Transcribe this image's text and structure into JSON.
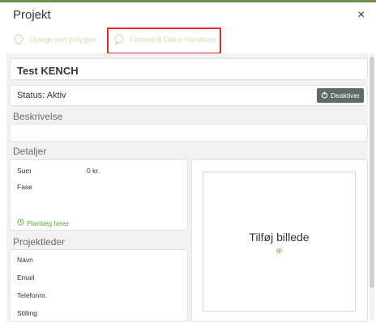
{
  "header": {
    "title": "Projekt",
    "close_glyph": "×",
    "accent_color": "#6f8f4a"
  },
  "toolbar": {
    "items": [
      {
        "label": "Optegn kort-polygon",
        "icon": "map-marker-icon"
      },
      {
        "label": "Forbind til Dalux Handover",
        "icon": "chat-bubble-icon"
      }
    ]
  },
  "project": {
    "name": "Test KENCH",
    "status_label": "Status:",
    "status_value": "Aktiv",
    "deactivate_label": "Deaktiver",
    "deactivate_color": "#5d6b6b"
  },
  "description": {
    "label": "Beskrivelse",
    "value": ""
  },
  "details": {
    "label": "Detaljer",
    "sum_label": "Sum",
    "sum_value": "0 kr.",
    "phase_label": "Fase",
    "plan_phases_label": "Planlæg faser",
    "plan_color": "#5fb13a"
  },
  "project_leader": {
    "label": "Projektleder",
    "fields": [
      "Navn",
      "Email",
      "Telefonnr.",
      "Stilling"
    ]
  },
  "image": {
    "label": "Tilføj billede",
    "plus_glyph": "⊕"
  }
}
